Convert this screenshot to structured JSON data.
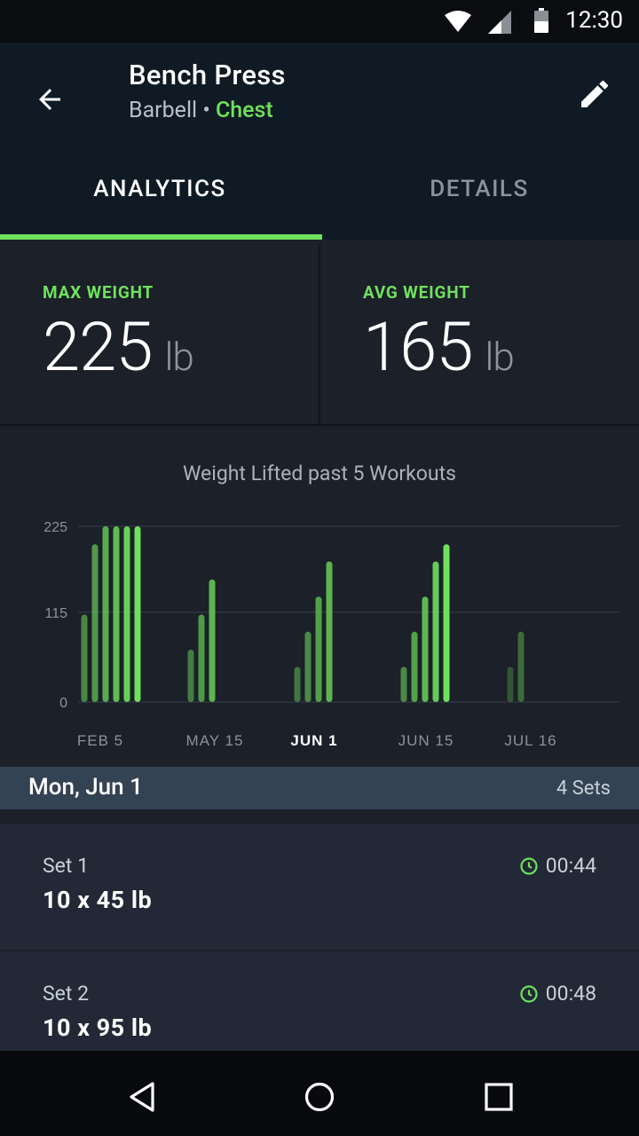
{
  "status_bar": {
    "time": "12:30"
  },
  "header": {
    "title": "Bench Press",
    "equipment": "Barbell",
    "separator": "•",
    "category": "Chest"
  },
  "tabs": [
    {
      "label": "ANALYTICS"
    },
    {
      "label": "DETAILS"
    }
  ],
  "stats": {
    "max": {
      "label": "MAX WEIGHT",
      "value": "225",
      "unit": "lb"
    },
    "avg": {
      "label": "AVG WEIGHT",
      "value": "165",
      "unit": "lb"
    }
  },
  "chart_data": {
    "type": "bar",
    "title": "Weight Lifted past 5 Workouts",
    "yticks": [
      "225",
      "115",
      "0"
    ],
    "ylim": [
      0,
      225
    ],
    "groups": [
      {
        "label": "FEB 5",
        "highlighted": false,
        "values": [
          112,
          202,
          225,
          225,
          225,
          225
        ],
        "bar_color": "#6fe15c"
      },
      {
        "label": "MAY 15",
        "highlighted": false,
        "values": [
          67,
          112,
          157
        ],
        "bar_color": "#5cb44f"
      },
      {
        "label": "JUN 1",
        "highlighted": true,
        "values": [
          45,
          90,
          135,
          180
        ],
        "bar_color": "#5cb44f"
      },
      {
        "label": "JUN 15",
        "highlighted": false,
        "values": [
          45,
          90,
          135,
          180,
          202
        ],
        "bar_color": "#6fe15c"
      },
      {
        "label": "JUL 16",
        "highlighted": false,
        "values": [
          45,
          90
        ],
        "bar_color": "#3d6a3a"
      }
    ],
    "grid": true,
    "legend": "none"
  },
  "day": {
    "date": "Mon, Jun 1",
    "count": "4 Sets"
  },
  "sets": [
    {
      "name": "Set 1",
      "detail": "10 x 45 lb",
      "time": "00:44"
    },
    {
      "name": "Set 2",
      "detail": "10 x 95 lb",
      "time": "00:48"
    }
  ],
  "colors": {
    "accent": "#6fe15c",
    "appbar": "#0f1a24",
    "background": "#1b2029",
    "day_header": "#334354"
  }
}
